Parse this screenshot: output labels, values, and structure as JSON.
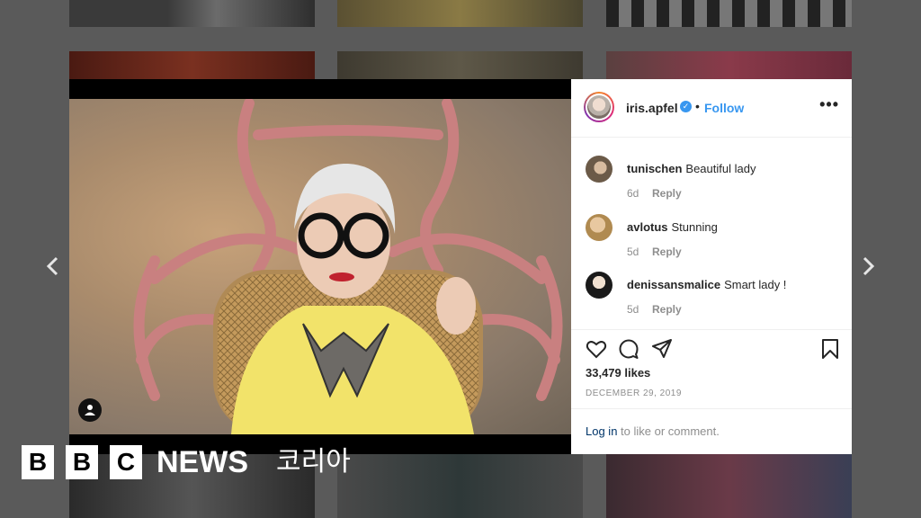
{
  "nav": {
    "prev_icon": "chevron-left-icon",
    "next_icon": "chevron-right-icon"
  },
  "post": {
    "username": "iris.apfel",
    "separator": "•",
    "follow_label": "Follow",
    "more_label": "•••",
    "likes": "33,479 likes",
    "date": "DECEMBER 29, 2019",
    "login_link": "Log in",
    "login_rest": " to like or comment."
  },
  "comments": [
    {
      "user": "tunischen",
      "text": "Beautiful lady",
      "age": "6d",
      "reply": "Reply"
    },
    {
      "user": "avlotus",
      "text": "Stunning",
      "age": "5d",
      "reply": "Reply"
    },
    {
      "user": "denissansmalice",
      "text": "Smart lady !",
      "age": "5d",
      "reply": "Reply"
    }
  ],
  "logo": {
    "b1": "B",
    "b2": "B",
    "b3": "C",
    "news": "NEWS",
    "region": "코리아"
  },
  "colors": {
    "accent": "#3897f0",
    "panel_bg": "#ffffff",
    "overlay": "#5a5a5a"
  }
}
